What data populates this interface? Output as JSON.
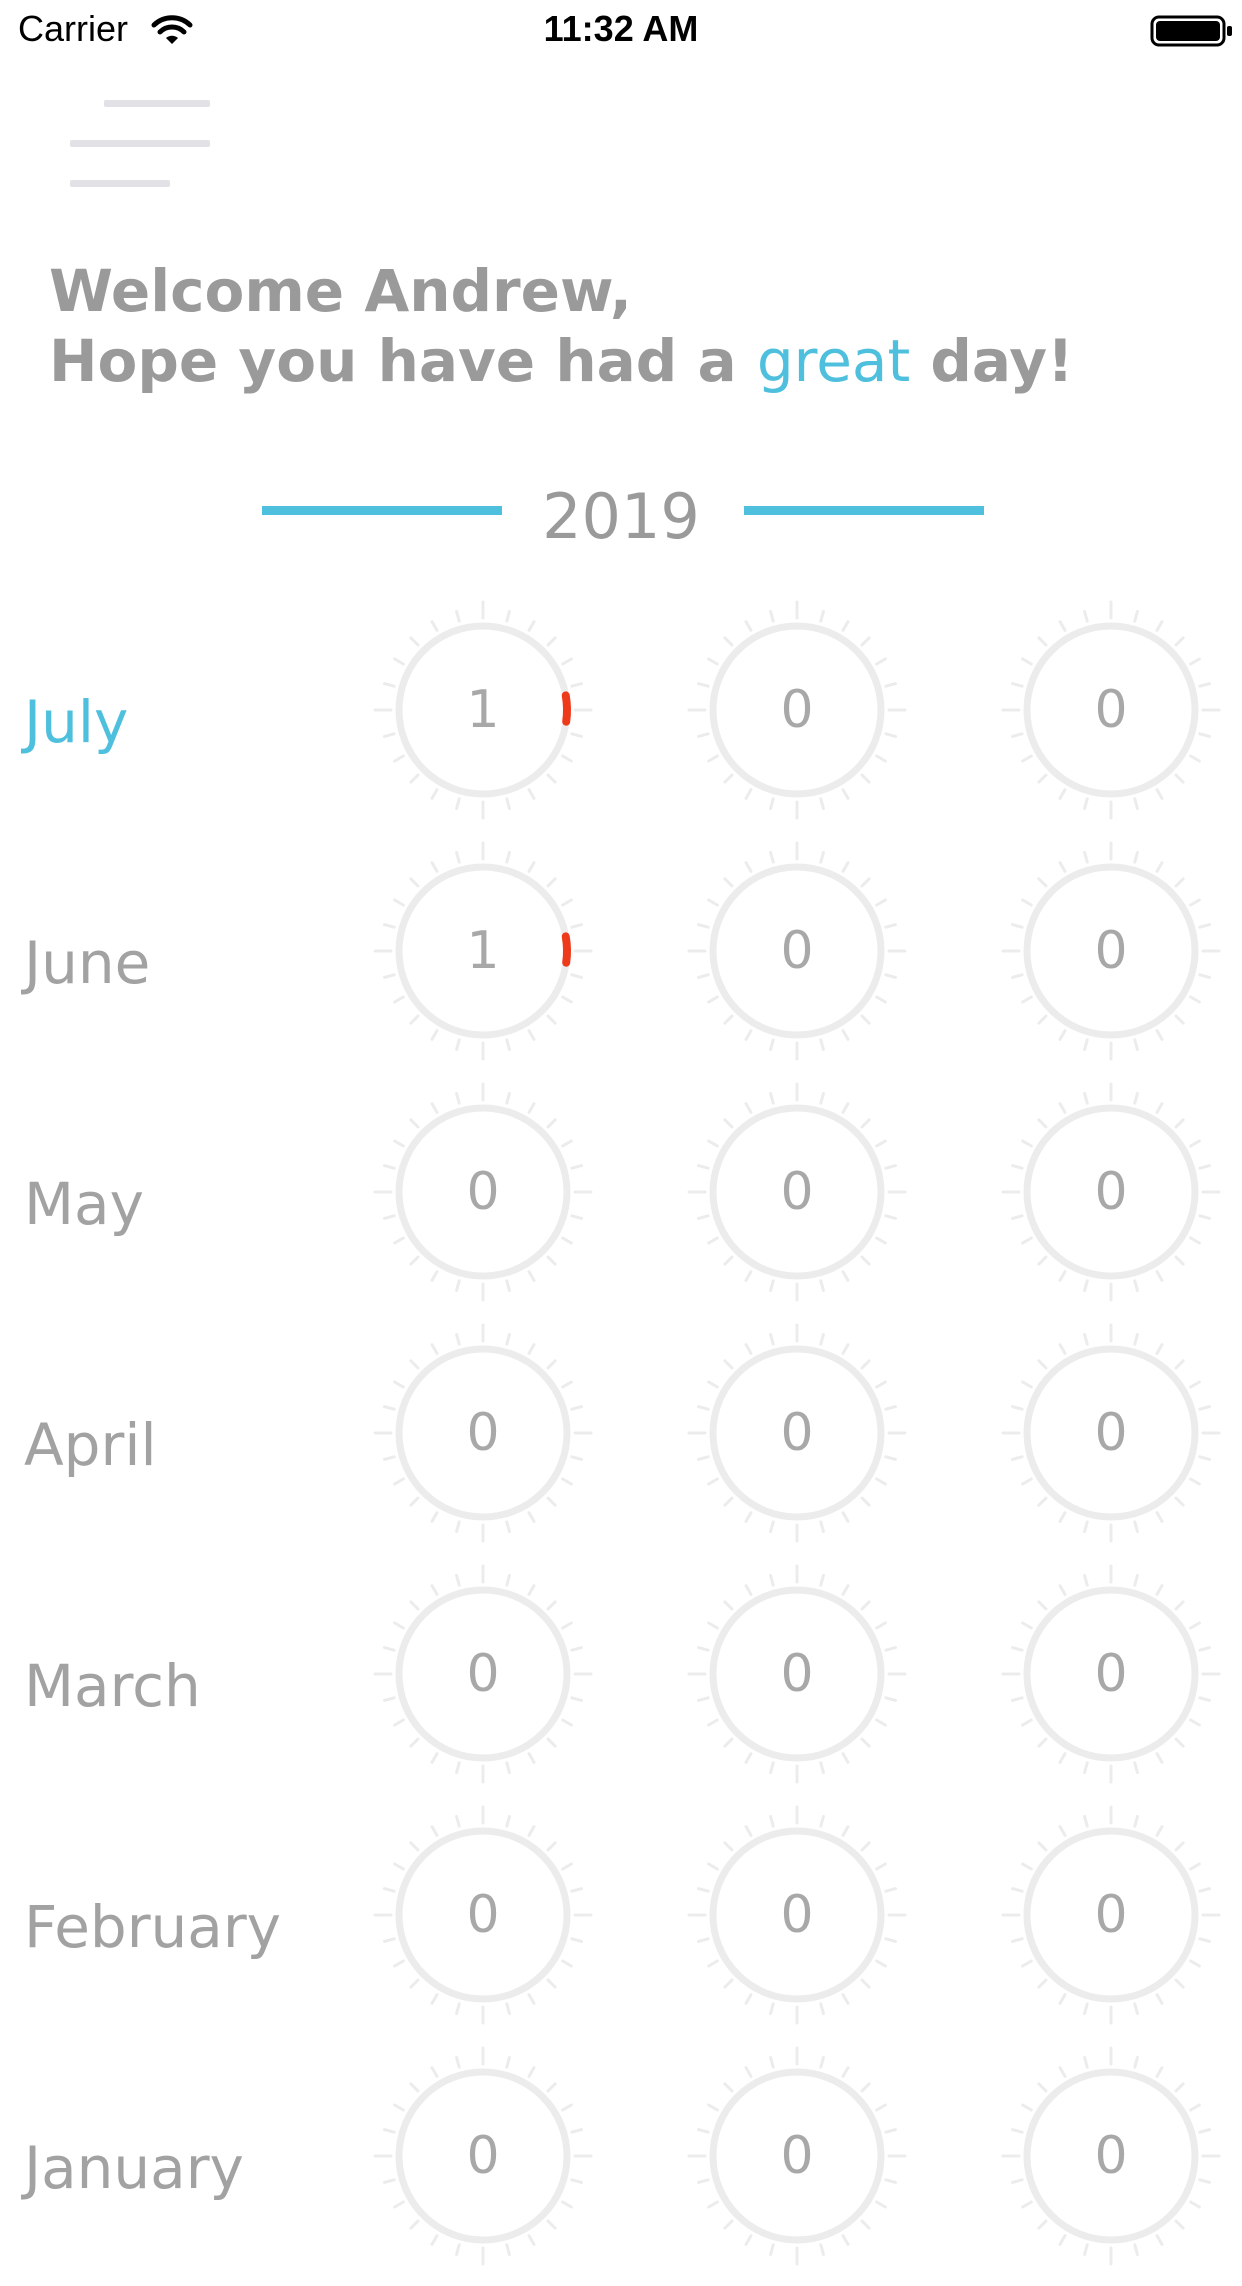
{
  "status_bar": {
    "carrier": "Carrier",
    "time": "11:32 AM"
  },
  "greeting": {
    "line1": "Welcome Andrew,",
    "line2_prefix": "Hope you have had a",
    "line2_accent": "great",
    "line2_suffix": "day!"
  },
  "year": "2019",
  "colors": {
    "accent": "#4ec0dd",
    "text": "#9a9a9a",
    "dial_ring": "#ececec",
    "progress": "#ee3a1a"
  },
  "months": [
    {
      "name": "July",
      "current": true,
      "values": [
        1,
        0,
        0
      ]
    },
    {
      "name": "June",
      "current": false,
      "values": [
        1,
        0,
        0
      ]
    },
    {
      "name": "May",
      "current": false,
      "values": [
        0,
        0,
        0
      ]
    },
    {
      "name": "April",
      "current": false,
      "values": [
        0,
        0,
        0
      ]
    },
    {
      "name": "March",
      "current": false,
      "values": [
        0,
        0,
        0
      ]
    },
    {
      "name": "February",
      "current": false,
      "values": [
        0,
        0,
        0
      ]
    },
    {
      "name": "January",
      "current": false,
      "values": [
        0,
        0,
        0
      ]
    }
  ]
}
